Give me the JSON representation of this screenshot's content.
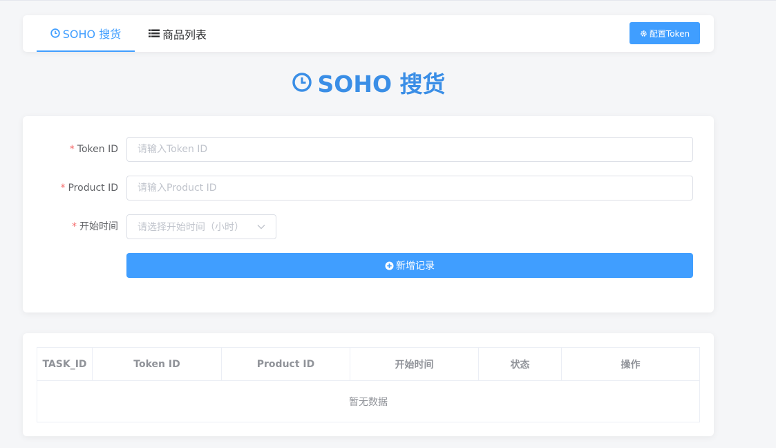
{
  "nav": {
    "tabs": [
      {
        "label": "SOHO 搜货",
        "icon": "clock-icon",
        "active": true
      },
      {
        "label": "商品列表",
        "icon": "list-icon",
        "active": false
      }
    ],
    "config_button": {
      "label": "配置Token",
      "icon": "gear-icon"
    }
  },
  "page": {
    "title": "SOHO 搜货",
    "title_icon": "clock-icon"
  },
  "form": {
    "token_id": {
      "label": "Token ID",
      "required_mark": "*",
      "value": "",
      "placeholder": "请输入Token ID"
    },
    "product_id": {
      "label": "Product ID",
      "required_mark": "*",
      "value": "",
      "placeholder": "请输入Product ID"
    },
    "start_time": {
      "label": "开始时间",
      "required_mark": "*",
      "placeholder": "请选择开始时间（小时）"
    },
    "add_button": {
      "label": "新增记录",
      "icon": "plus-circle-icon"
    }
  },
  "table": {
    "columns": [
      "TASK_ID",
      "Token ID",
      "Product ID",
      "开始时间",
      "状态",
      "操作"
    ],
    "rows": [],
    "empty_text": "暂无数据"
  },
  "colors": {
    "primary": "#409eff",
    "title": "#3a8ee6",
    "required": "#f56c6c",
    "background": "#f5f6f8"
  }
}
